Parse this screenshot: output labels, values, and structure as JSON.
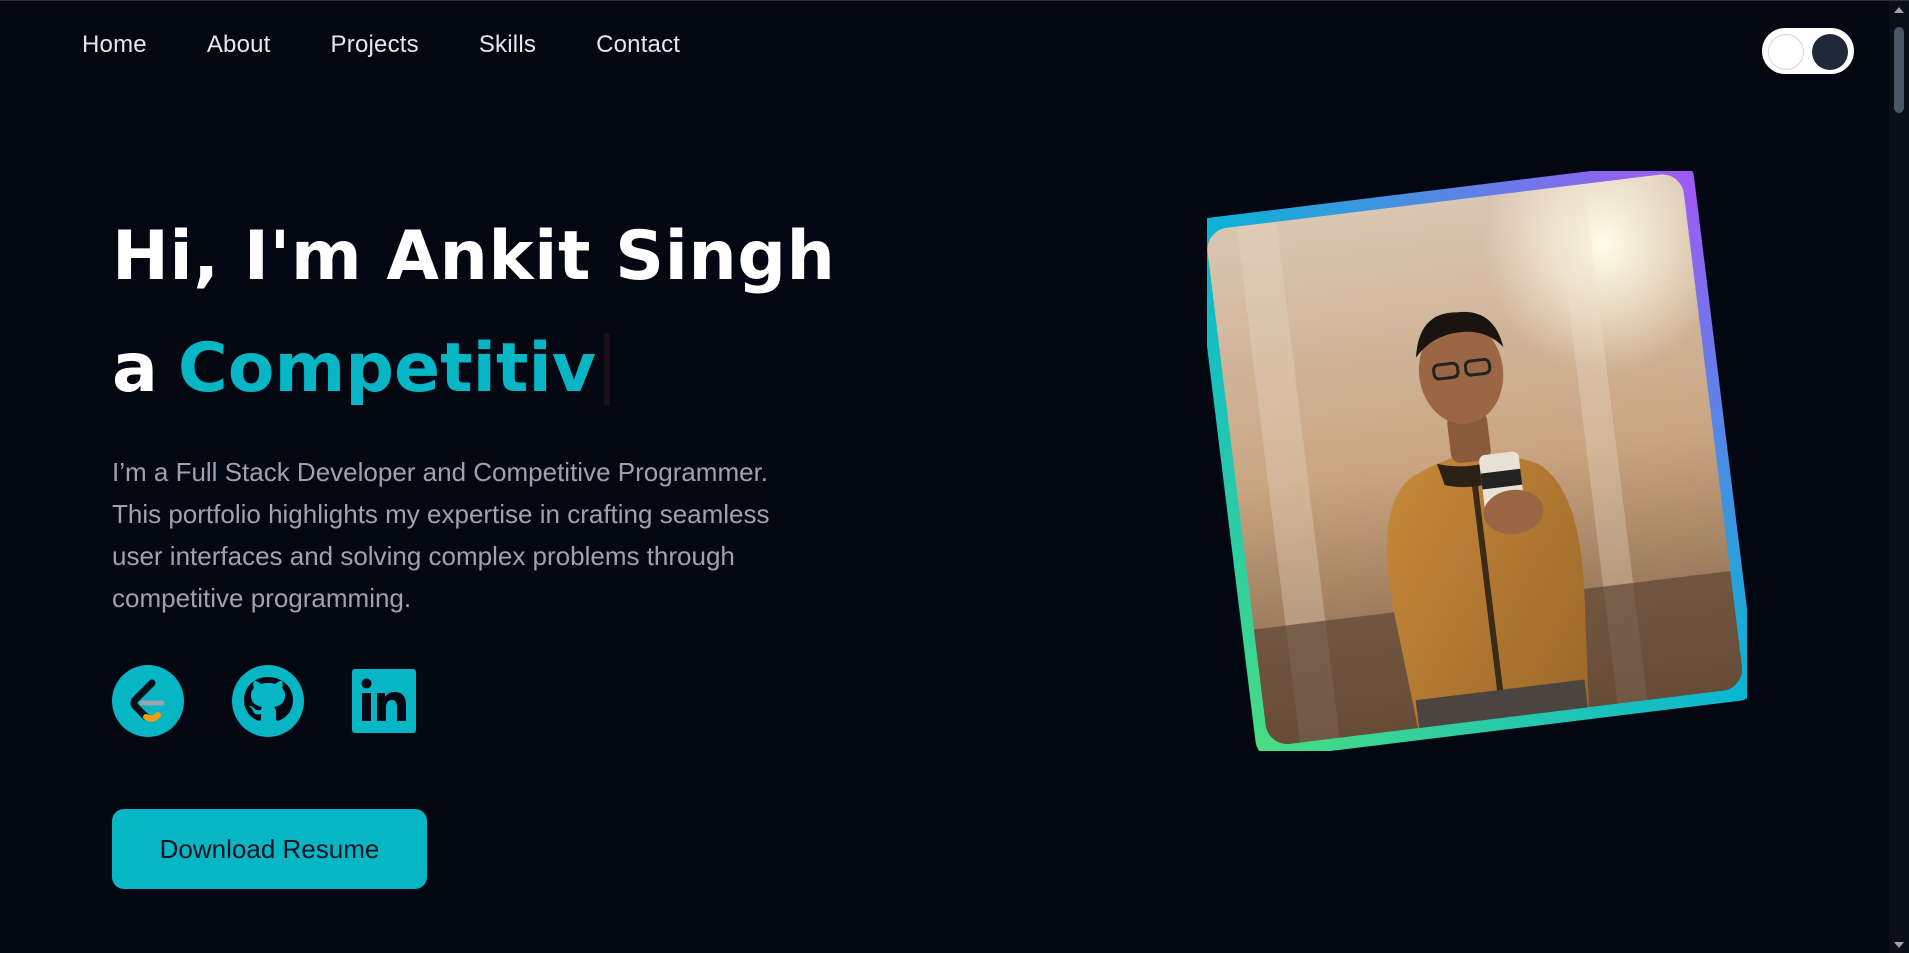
{
  "nav": {
    "items": [
      {
        "label": "Home"
      },
      {
        "label": "About"
      },
      {
        "label": "Projects"
      },
      {
        "label": "Skills"
      },
      {
        "label": "Contact"
      }
    ],
    "theme_toggle_icon": "theme-toggle"
  },
  "hero": {
    "greeting": "Hi, I'm Ankit Singh",
    "prefix": "a",
    "role_typed": "Competitiv",
    "intro": "I’m a Full Stack Developer and Competitive Programmer. This portfolio highlights my expertise in crafting seamless user interfaces and solving complex problems through competitive programming."
  },
  "social": [
    {
      "icon": "leetcode-icon"
    },
    {
      "icon": "github-icon"
    },
    {
      "icon": "linkedin-icon"
    }
  ],
  "actions": {
    "download_label": "Download Resume"
  },
  "colors": {
    "accent": "#06b6c4",
    "background": "#030712",
    "frame_gradient": [
      "#4ade80",
      "#06b6d4",
      "#a855f7"
    ]
  }
}
